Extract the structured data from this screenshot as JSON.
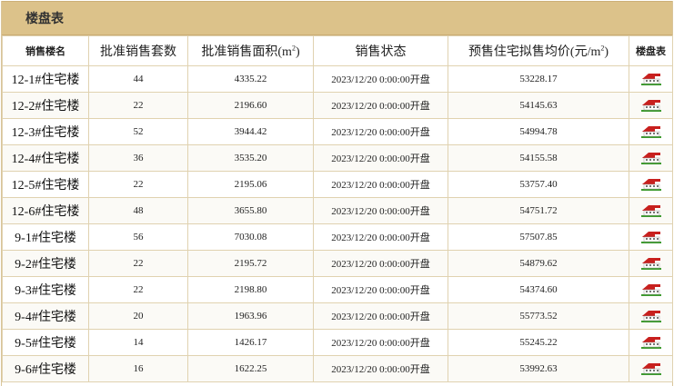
{
  "panel": {
    "title": "楼盘表"
  },
  "table": {
    "headers": {
      "building_name": "销售楼名",
      "approved_units": "批准销售套数",
      "approved_area": "批准销售面积(m",
      "approved_area_sup": "2",
      "approved_area_close": ")",
      "sale_status": "销售状态",
      "avg_price": "预售住宅拟售均价(元/m",
      "avg_price_sup": "2",
      "avg_price_close": ")",
      "floor_plan": "楼盘表"
    },
    "rows": [
      {
        "name": "12-1#住宅楼",
        "units": "44",
        "area": "4335.22",
        "status": "2023/12/20 0:00:00开盘",
        "price": "53228.17",
        "icon": "house-icon"
      },
      {
        "name": "12-2#住宅楼",
        "units": "22",
        "area": "2196.60",
        "status": "2023/12/20 0:00:00开盘",
        "price": "54145.63",
        "icon": "house-icon"
      },
      {
        "name": "12-3#住宅楼",
        "units": "52",
        "area": "3944.42",
        "status": "2023/12/20 0:00:00开盘",
        "price": "54994.78",
        "icon": "house-icon"
      },
      {
        "name": "12-4#住宅楼",
        "units": "36",
        "area": "3535.20",
        "status": "2023/12/20 0:00:00开盘",
        "price": "54155.58",
        "icon": "house-icon"
      },
      {
        "name": "12-5#住宅楼",
        "units": "22",
        "area": "2195.06",
        "status": "2023/12/20 0:00:00开盘",
        "price": "53757.40",
        "icon": "house-icon"
      },
      {
        "name": "12-6#住宅楼",
        "units": "48",
        "area": "3655.80",
        "status": "2023/12/20 0:00:00开盘",
        "price": "54751.72",
        "icon": "house-icon"
      },
      {
        "name": "9-1#住宅楼",
        "units": "56",
        "area": "7030.08",
        "status": "2023/12/20 0:00:00开盘",
        "price": "57507.85",
        "icon": "house-icon"
      },
      {
        "name": "9-2#住宅楼",
        "units": "22",
        "area": "2195.72",
        "status": "2023/12/20 0:00:00开盘",
        "price": "54879.62",
        "icon": "house-icon"
      },
      {
        "name": "9-3#住宅楼",
        "units": "22",
        "area": "2198.80",
        "status": "2023/12/20 0:00:00开盘",
        "price": "54374.60",
        "icon": "house-icon"
      },
      {
        "name": "9-4#住宅楼",
        "units": "20",
        "area": "1963.96",
        "status": "2023/12/20 0:00:00开盘",
        "price": "55773.52",
        "icon": "house-icon"
      },
      {
        "name": "9-5#住宅楼",
        "units": "14",
        "area": "1426.17",
        "status": "2023/12/20 0:00:00开盘",
        "price": "55245.22",
        "icon": "house-icon"
      },
      {
        "name": "9-6#住宅楼",
        "units": "16",
        "area": "1622.25",
        "status": "2023/12/20 0:00:00开盘",
        "price": "53992.63",
        "icon": "house-icon"
      }
    ]
  },
  "colors": {
    "header_bar": "#dcc28a",
    "border": "#e0d2b0",
    "roof": "#c8201e",
    "house_wall": "#ffffff",
    "lawn": "#3c9a2e"
  }
}
